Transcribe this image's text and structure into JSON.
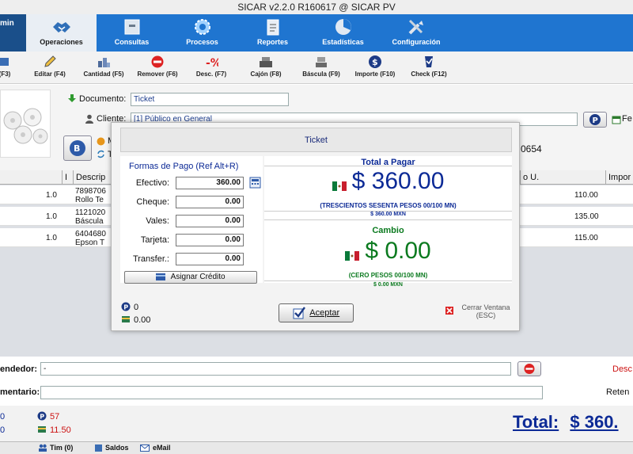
{
  "window": {
    "title": "SICAR v2.2.0 R160617 @ SICAR PV"
  },
  "nav": {
    "user": "min",
    "tabs": [
      {
        "label": "Operaciones"
      },
      {
        "label": "Consultas"
      },
      {
        "label": "Procesos"
      },
      {
        "label": "Reportes"
      },
      {
        "label": "Estadísticas"
      },
      {
        "label": "Configuración"
      }
    ]
  },
  "toolbar": {
    "items": [
      {
        "label": "(F3)"
      },
      {
        "label": "Editar (F4)"
      },
      {
        "label": "Cantidad (F5)"
      },
      {
        "label": "Remover (F6)"
      },
      {
        "label": "Desc. (F7)"
      },
      {
        "label": "Cajón (F8)"
      },
      {
        "label": "Báscula (F9)"
      },
      {
        "label": "Importe (F10)"
      },
      {
        "label": "Check (F12)"
      }
    ]
  },
  "form": {
    "documento_label": "Documento:",
    "documento_value": "Ticket",
    "cliente_label": "Cliente:",
    "cliente_value": "[1] Público en General",
    "fecha_label": "Fe",
    "phone_partial": "0654",
    "m_partial": "M",
    "t_partial": "T"
  },
  "table": {
    "headers": [
      "I",
      "Descrip",
      "o U.",
      "Impor"
    ],
    "rows": [
      {
        "qty": "1.0",
        "code": "7898706",
        "desc": "Rollo Te",
        "price": "110.00"
      },
      {
        "qty": "1.0",
        "code": "1121020",
        "desc": "Báscula",
        "price": "135.00"
      },
      {
        "qty": "1.0",
        "code": "6404680",
        "desc": "Epson T",
        "price": "115.00"
      }
    ]
  },
  "bottom": {
    "vendedor_label": "endedor:",
    "vendedor_value": "-",
    "comentario_label": "mentario:",
    "desc_label": "Desc",
    "reten_label": "Reten",
    "counter1_left": "0",
    "counter1_value": "57",
    "counter2_left": "0",
    "counter2_value": "11.50",
    "total_label": "Total:",
    "total_value": "$ 360."
  },
  "statusbar": {
    "tim": "Tim (0)",
    "saldos": "Saldos",
    "email": "eMail"
  },
  "modal": {
    "title": "Ticket",
    "formas_title": "Formas de Pago (Ref Alt+R)",
    "fields": [
      {
        "label": "Efectivo:",
        "value": "360.00"
      },
      {
        "label": "Cheque:",
        "value": "0.00"
      },
      {
        "label": "Vales:",
        "value": "0.00"
      },
      {
        "label": "Tarjeta:",
        "value": "0.00"
      },
      {
        "label": "Transfer.:",
        "value": "0.00"
      }
    ],
    "assign_label": "Asignar Crédito",
    "total_title": "Total a Pagar",
    "total_amount": "$ 360.00",
    "total_words": "(TRESCIENTOS SESENTA PESOS 00/100 MN)",
    "total_mxn": "$ 360.00 MXN",
    "cambio_title": "Cambio",
    "cambio_amount": "$ 0.00",
    "cambio_words": "(CERO PESOS 00/100 MN)",
    "cambio_mxn": "$ 0.00 MXN",
    "points_value": "0",
    "credit_value": "0.00",
    "accept_label": "Aceptar",
    "close_label": "Cerrar Ventana",
    "close_key": "(ESC)"
  },
  "colors": {
    "nav_blue": "#1f75d0",
    "total_blue": "#0c2a96",
    "change_green": "#0b7a1f",
    "alert_red": "#cc1111"
  }
}
